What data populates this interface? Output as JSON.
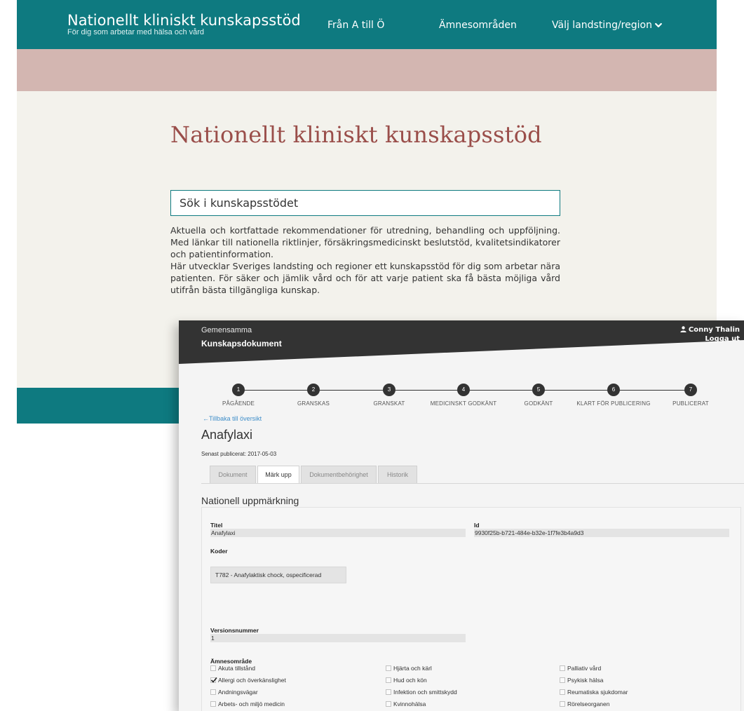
{
  "site": {
    "title": "Nationellt kliniskt kunskapsstöd",
    "subtitle": "För dig som arbetar med hälsa och vård",
    "nav": {
      "a_till_o": "Från A till Ö",
      "amnesomraden": "Ämnesområden",
      "region": "Välj landsting/region"
    },
    "hero_title": "Nationellt kliniskt kunskapsstöd",
    "search": {
      "placeholder": "Sök i kunskapsstödet"
    },
    "description": [
      "Aktuella och kortfattade rekommendationer för utredning, behandling och uppföljning. Med länkar till nationella riktlinjer, försäkringsmedicinskt beslutstöd, kvalitetsindikatorer och patientinformation.",
      "Här utvecklar Sveriges landsting och regioner ett kunskapsstöd för dig som arbetar nära patienten. För säker och jämlik vård och för att varje patient ska få bästa möjliga vård utifrån bästa tillgängliga kunskap."
    ],
    "colors": {
      "header": "#0e7a80",
      "band": "#d3b6b1",
      "hero": "#9a4e4a"
    }
  },
  "admin": {
    "header": {
      "subtitle": "Gemensamma",
      "title": "Kunskapsdokument",
      "user_name": "Conny Thalin",
      "logout": "Logga ut"
    },
    "steps": [
      {
        "number": "1",
        "label": "PÅGÅENDE"
      },
      {
        "number": "2",
        "label": "GRANSKAS"
      },
      {
        "number": "3",
        "label": "GRANSKAT"
      },
      {
        "number": "4",
        "label": "MEDICINSKT GODKÄNT"
      },
      {
        "number": "5",
        "label": "GODKÄNT"
      },
      {
        "number": "6",
        "label": "KLART FÖR PUBLICERING"
      },
      {
        "number": "7",
        "label": "PUBLICERAT"
      }
    ],
    "back_link": "Tillbaka till översikt",
    "document_title": "Anafylaxi",
    "last_published": "Senast publicerat: 2017-05-03",
    "tabs": [
      {
        "label": "Dokument",
        "active": false
      },
      {
        "label": "Märk upp",
        "active": true
      },
      {
        "label": "Dokumentbehörighet",
        "active": false
      },
      {
        "label": "Historik",
        "active": false
      }
    ],
    "section_title": "Nationell uppmärkning",
    "form": {
      "titel_label": "Titel",
      "titel_value": "Anafylaxi",
      "id_label": "Id",
      "id_value": "9930f25b-b721-484e-b32e-1f7fe3b4a9d3",
      "koder_label": "Koder",
      "kod_value": "T782 - Anafylaktisk chock, ospecificerad",
      "version_label": "Versionsnummer",
      "version_value": "1",
      "amnesomrade_label": "Ämnesområde",
      "amnesomraden": [
        {
          "label": "Akuta tillstånd",
          "checked": false
        },
        {
          "label": "Hjärta och kärl",
          "checked": false
        },
        {
          "label": "Palliativ vård",
          "checked": false
        },
        {
          "label": "Allergi och överkänslighet",
          "checked": true
        },
        {
          "label": "Hud och kön",
          "checked": false
        },
        {
          "label": "Psykisk hälsa",
          "checked": false
        },
        {
          "label": "Andningsvägar",
          "checked": false
        },
        {
          "label": "Infektion och smittskydd",
          "checked": false
        },
        {
          "label": "Reumatiska sjukdomar",
          "checked": false
        },
        {
          "label": "Arbets- och miljö medicin",
          "checked": false
        },
        {
          "label": "Kvinnohälsa",
          "checked": false
        },
        {
          "label": "Rörelseorganen",
          "checked": false
        }
      ]
    },
    "colors": {
      "header": "#333333",
      "link": "#3f8ec9"
    }
  }
}
